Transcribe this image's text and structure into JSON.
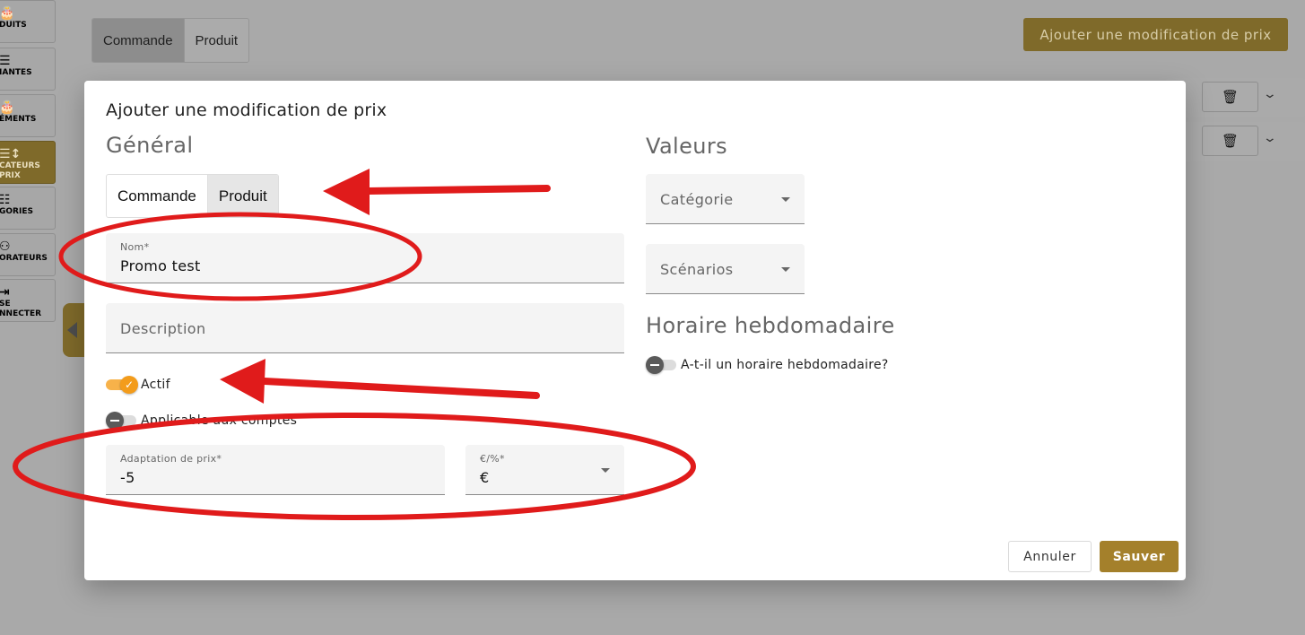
{
  "sidebar": {
    "items": [
      {
        "label": "DUITS",
        "icon": "products-icon"
      },
      {
        "label": "IANTES",
        "icon": "list-icon"
      },
      {
        "label": "ÉMENTS",
        "icon": "supplements-icon"
      },
      {
        "label": "CATEURS\nPRIX",
        "icon": "price-modifiers-icon",
        "active": true
      },
      {
        "label": "GORIES",
        "icon": "categories-icon"
      },
      {
        "label": "ORATEURS",
        "icon": "collaborators-icon"
      },
      {
        "label": "SE\nNNECTER",
        "icon": "logout-icon"
      }
    ]
  },
  "background": {
    "toggle": {
      "left": "Commande",
      "right": "Produit"
    },
    "add_button": "Ajouter une modification de prix"
  },
  "modal": {
    "title": "Ajouter une modification de prix",
    "general_title": "Général",
    "values_title": "Valeurs",
    "schedule_title": "Horaire hebdomadaire",
    "mode_toggle": {
      "left": "Commande",
      "right": "Produit",
      "selected": "Produit"
    },
    "name_field": {
      "label": "Nom*",
      "value": "Promo test"
    },
    "description_field": {
      "placeholder": "Description"
    },
    "active_toggle": {
      "label": "Actif",
      "on": true
    },
    "applicable_toggle": {
      "label": "Applicable aux comptes",
      "on": false
    },
    "price_adaptation": {
      "label": "Adaptation de prix*",
      "value": "-5"
    },
    "unit_select": {
      "label": "€/%*",
      "value": "€"
    },
    "category_select": {
      "placeholder": "Catégorie"
    },
    "scenarios_select": {
      "placeholder": "Scénarios"
    },
    "weekly_toggle": {
      "label": "A-t-il un horaire hebdomadaire?",
      "on": false
    },
    "cancel_label": "Annuler",
    "save_label": "Sauver"
  },
  "colors": {
    "accent": "#a4802b",
    "toggle_on": "#f39c1b",
    "annotation": "#e01b1b",
    "overlay": "#a9a9a9"
  }
}
